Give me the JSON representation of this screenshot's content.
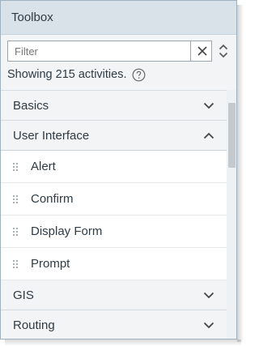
{
  "panel": {
    "title": "Toolbox"
  },
  "filter": {
    "placeholder": "Filter",
    "value": "",
    "clear_icon": "close-icon",
    "sort_icon": "sort-updown-icon"
  },
  "status": {
    "text": "Showing 215 activities.",
    "help_icon": "question-circle-icon"
  },
  "categories": [
    {
      "label": "Basics",
      "expanded": false
    },
    {
      "label": "User Interface",
      "expanded": true,
      "items": [
        "Alert",
        "Confirm",
        "Display Form",
        "Prompt"
      ]
    },
    {
      "label": "GIS",
      "expanded": false
    },
    {
      "label": "Routing",
      "expanded": false
    }
  ]
}
